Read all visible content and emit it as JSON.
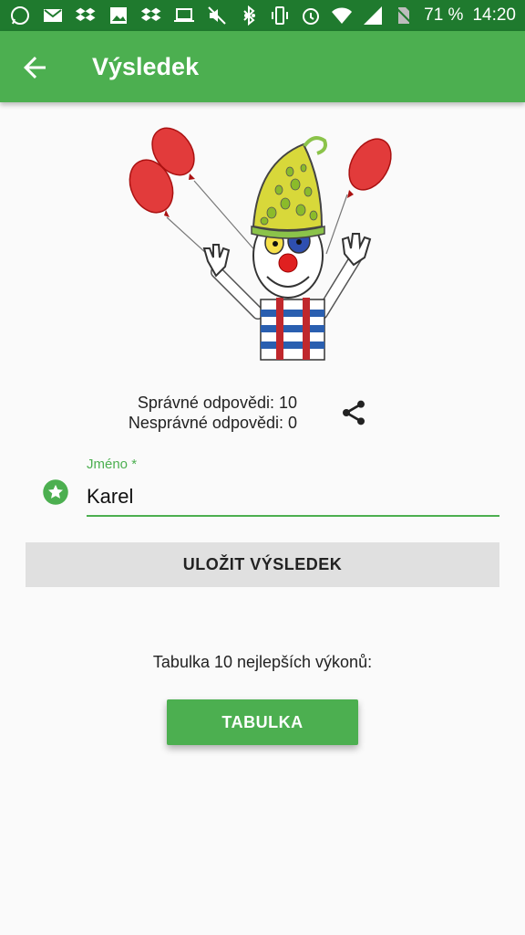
{
  "status_bar": {
    "left_icons": [
      "whatsapp-icon",
      "gmail-icon",
      "dropbox-icon",
      "gallery-icon",
      "dropbox-icon",
      "laptop-icon",
      "mute-icon",
      "more-dots-icon"
    ],
    "right_icons": [
      "bluetooth-icon",
      "vibrate-icon",
      "alarm-icon",
      "wifi-icon",
      "signal-icon",
      "no-sim-icon"
    ],
    "battery": "71 %",
    "time": "14:20"
  },
  "app_bar": {
    "title": "Výsledek",
    "back_icon": "arrow-back-icon",
    "color": "#4caf50",
    "status_color": "#1f7a2e"
  },
  "result": {
    "correct": "Správné odpovědi: 10",
    "wrong": "Nesprávné odpovědi: 0",
    "share_icon": "share-icon"
  },
  "name_field": {
    "label": "Jméno *",
    "value": "Karel",
    "icon": "star-icon"
  },
  "save_button": {
    "label": "ULOŽIT VÝSLEDEK"
  },
  "leaderboard": {
    "caption": "Tabulka 10 nejlepších výkonů:",
    "button_label": "TABULKA"
  },
  "accent": "#4caf50"
}
